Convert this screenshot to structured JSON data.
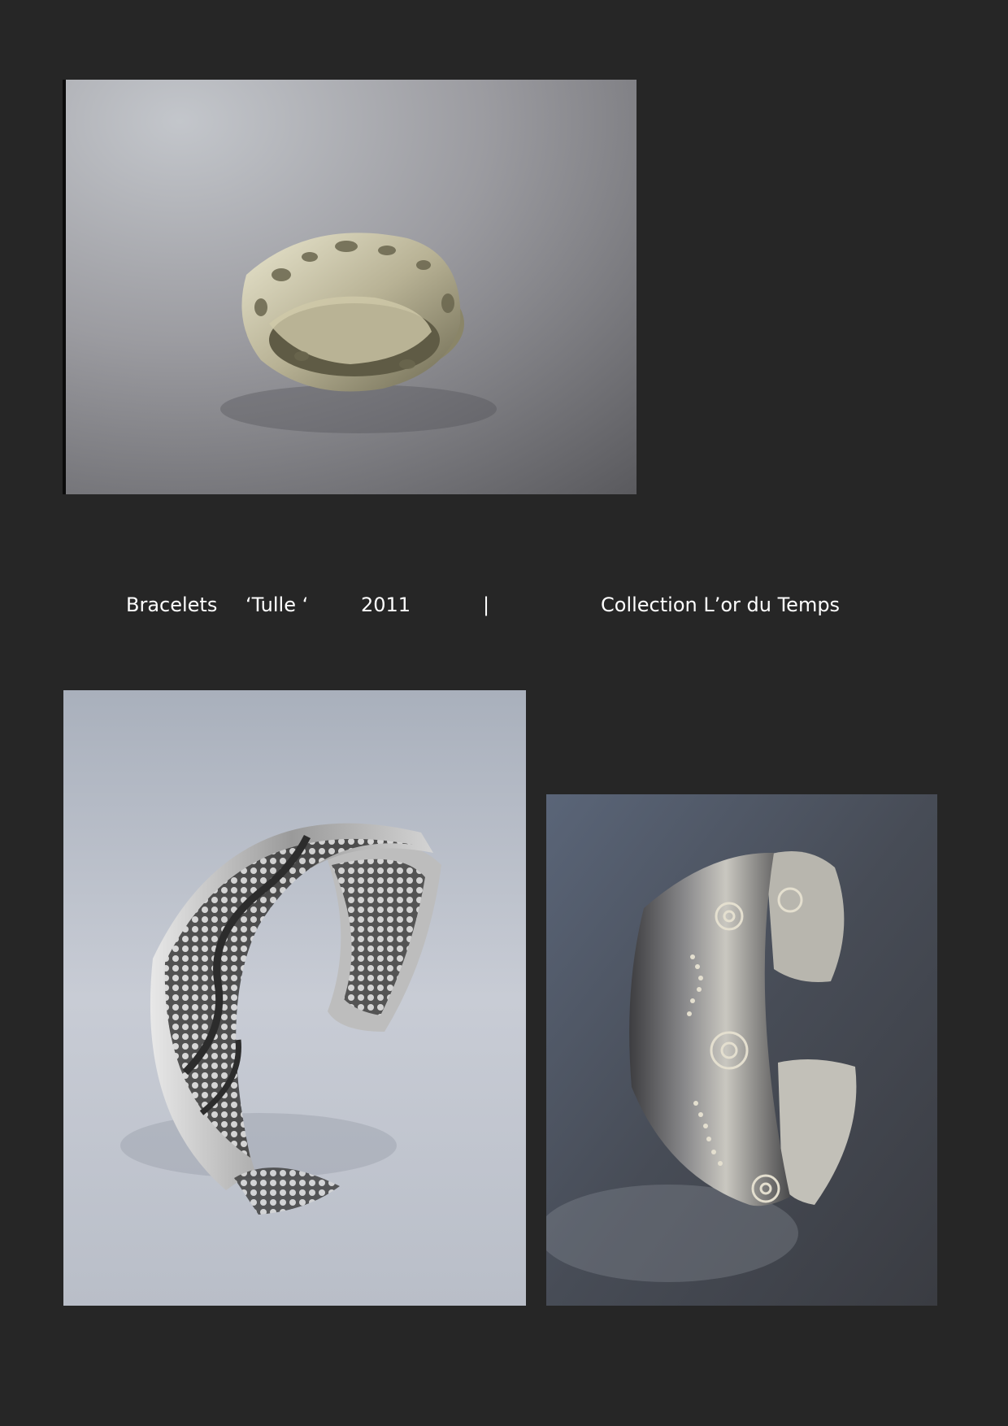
{
  "caption": {
    "product": "Bracelets",
    "name": "‘Tulle ‘",
    "year": "2011",
    "separator": "|",
    "collection": "Collection  L’or du Temps"
  },
  "colors": {
    "background": "#262626",
    "text": "#ffffff"
  }
}
